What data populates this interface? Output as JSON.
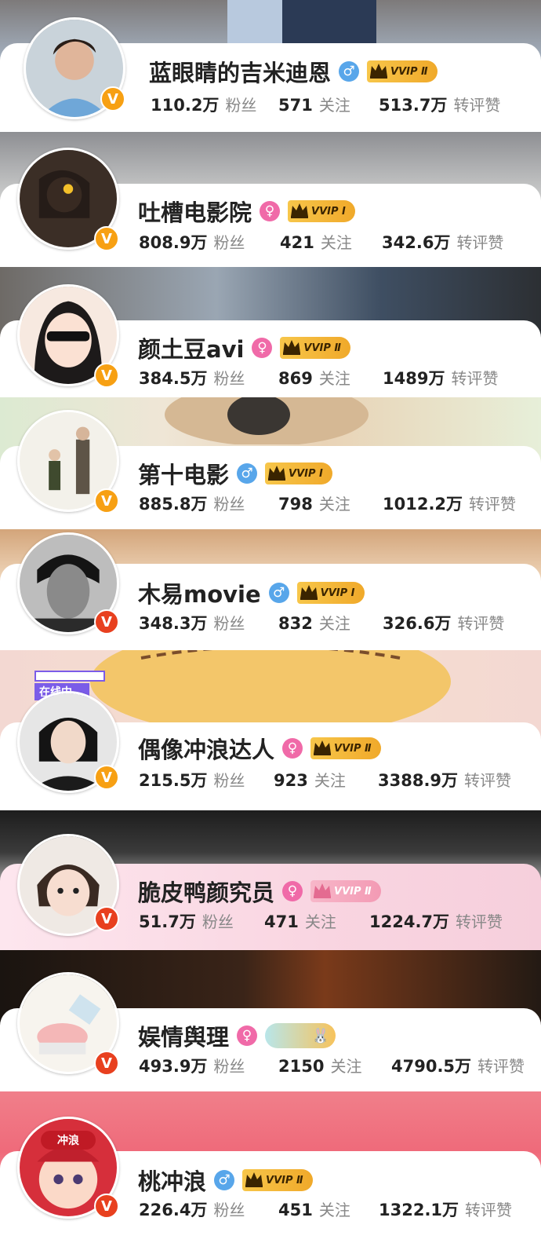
{
  "accounts": [
    {
      "name": "蓝眼睛的吉米迪恩",
      "gender": "male",
      "vip": "VVIP Ⅱ",
      "followers": "110.2万",
      "followers_label": "粉丝",
      "following": "571",
      "following_label": "关注",
      "engagement": "513.7万",
      "engagement_label": "转评赞",
      "badge_color": "orange"
    },
    {
      "name": "吐槽电影院",
      "gender": "female",
      "vip": "VVIP Ⅰ",
      "followers": "808.9万",
      "followers_label": "粉丝",
      "following": "421",
      "following_label": "关注",
      "engagement": "342.6万",
      "engagement_label": "转评赞",
      "badge_color": "orange"
    },
    {
      "name": "颜土豆avi",
      "gender": "female",
      "vip": "VVIP Ⅱ",
      "followers": "384.5万",
      "followers_label": "粉丝",
      "following": "869",
      "following_label": "关注",
      "engagement": "1489万",
      "engagement_label": "转评赞",
      "badge_color": "orange"
    },
    {
      "name": "第十电影",
      "gender": "male",
      "vip": "VVIP Ⅰ",
      "followers": "885.8万",
      "followers_label": "粉丝",
      "following": "798",
      "following_label": "关注",
      "engagement": "1012.2万",
      "engagement_label": "转评赞",
      "badge_color": "orange"
    },
    {
      "name": "木易movie",
      "gender": "male",
      "vip": "VVIP Ⅰ",
      "followers": "348.3万",
      "followers_label": "粉丝",
      "following": "832",
      "following_label": "关注",
      "engagement": "326.6万",
      "engagement_label": "转评赞",
      "badge_color": "red"
    },
    {
      "name": "偶像冲浪达人",
      "gender": "female",
      "vip": "VVIP Ⅱ",
      "followers": "215.5万",
      "followers_label": "粉丝",
      "following": "923",
      "following_label": "关注",
      "engagement": "3388.9万",
      "engagement_label": "转评赞",
      "badge_color": "orange",
      "live_text": "在线中..."
    },
    {
      "name": "脆皮鸭颜究员",
      "gender": "female",
      "vip": "VVIP Ⅱ",
      "followers": "51.7万",
      "followers_label": "粉丝",
      "following": "471",
      "following_label": "关注",
      "engagement": "1224.7万",
      "engagement_label": "转评赞",
      "badge_color": "red"
    },
    {
      "name": "娱情舆理",
      "gender": "female",
      "vip": "",
      "followers": "493.9万",
      "followers_label": "粉丝",
      "following": "2150",
      "following_label": "关注",
      "engagement": "4790.5万",
      "engagement_label": "转评赞",
      "badge_color": "red"
    },
    {
      "name": "桃冲浪",
      "gender": "male",
      "vip": "VVIP Ⅱ",
      "followers": "226.4万",
      "followers_label": "粉丝",
      "following": "451",
      "following_label": "关注",
      "engagement": "1322.1万",
      "engagement_label": "转评赞",
      "badge_color": "red",
      "avatar_badge_text": "冲浪"
    }
  ],
  "colors": {
    "male": "#58a6ea",
    "female": "#f06aa8",
    "vvip_gold": "#f0a92a",
    "v_orange": "#f7a013",
    "v_red": "#e8401f"
  }
}
